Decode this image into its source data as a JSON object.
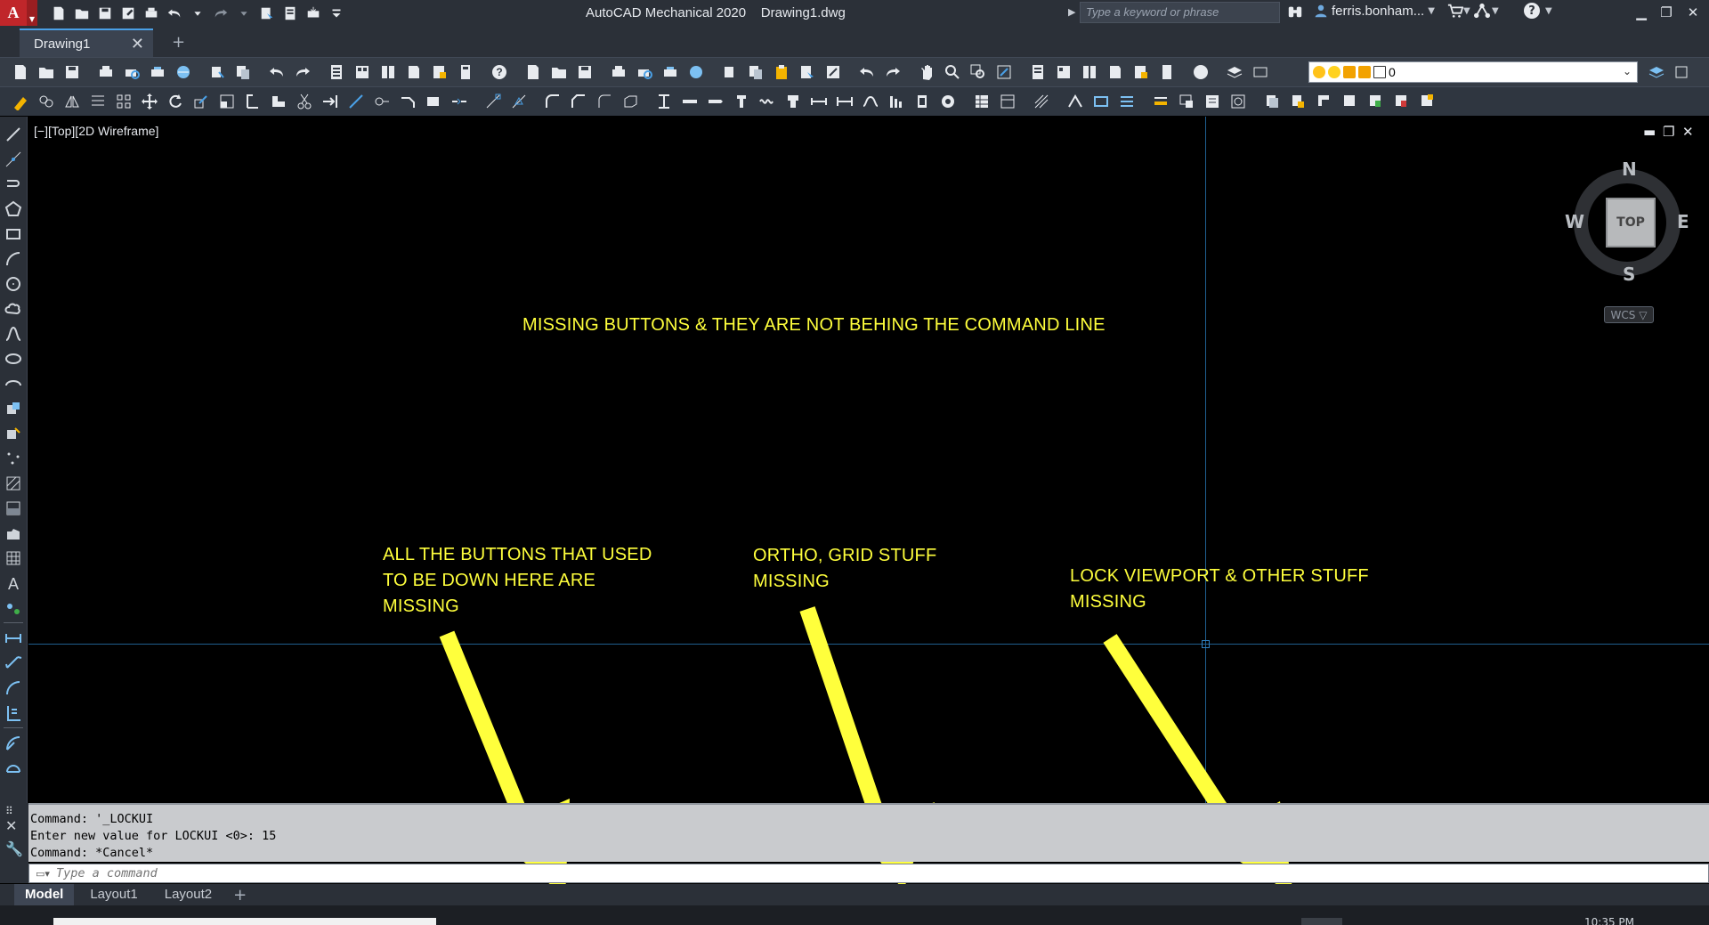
{
  "titlebar": {
    "app_title": "AutoCAD Mechanical 2020",
    "file_name": "Drawing1.dwg",
    "logo_letter": "A",
    "search_placeholder": "Type a keyword or phrase",
    "user_name": "ferris.bonham...",
    "help_glyph": "?"
  },
  "tabs": {
    "doc_tab": "Drawing1",
    "close": "✕",
    "add": "+"
  },
  "layer_combo": {
    "value": "0",
    "colors": [
      "#ffc21a",
      "#ffd21f",
      "#f2a200",
      "#ffffff"
    ]
  },
  "viewport": {
    "label": "[−][Top][2D Wireframe]",
    "controls": [
      "▬",
      "❐",
      "✕"
    ]
  },
  "viewcube": {
    "top": "TOP",
    "north": "N",
    "south": "S",
    "east": "E",
    "west": "W",
    "wcs": "WCS ▽"
  },
  "annotations": {
    "top_note": "MISSING BUTTONS & THEY ARE NOT BEHING THE COMMAND LINE",
    "note1": [
      "ALL THE BUTTONS THAT USED",
      "TO BE DOWN HERE ARE",
      "MISSING"
    ],
    "note2": [
      "ORTHO, GRID STUFF",
      "MISSING"
    ],
    "note3": [
      "LOCK VIEWPORT & OTHER STUFF",
      "MISSING"
    ],
    "arrow_color": "#ffff3c"
  },
  "command": {
    "history": [
      "Command: '_LOCKUI",
      "Enter new value for LOCKUI <0>: 15",
      "Command: *Cancel*"
    ],
    "placeholder": "Type a command"
  },
  "layouts": {
    "tabs": [
      "Model",
      "Layout1",
      "Layout2"
    ],
    "add": "+"
  },
  "taskbar": {
    "clock": "10:35 PM"
  },
  "colors": {
    "chrome_dark": "#2b3038",
    "toolbar": "#353c46",
    "accent_blue": "#4aa0e6",
    "crosshair": "#1f5f8f",
    "annotation_yellow": "#ffff3c"
  }
}
